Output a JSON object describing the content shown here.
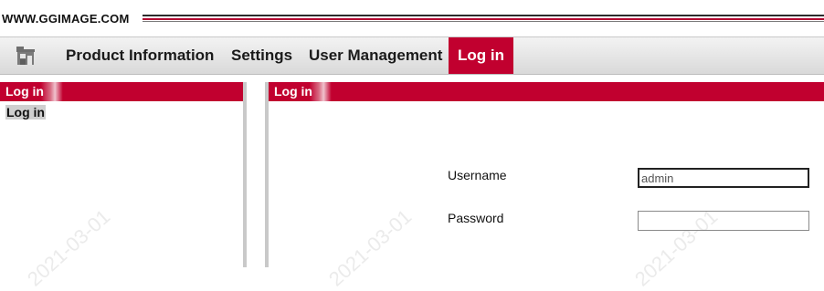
{
  "brand": {
    "site": "WWW.GGIMAGE.COM"
  },
  "nav": {
    "items": [
      {
        "label": "Product Information"
      },
      {
        "label": "Settings"
      },
      {
        "label": "User Management"
      },
      {
        "label": "Log in",
        "active": true
      }
    ],
    "home_icon": "home-icon"
  },
  "sidebar": {
    "header": "Log in",
    "link": "Log in"
  },
  "main": {
    "header": "Log in",
    "username_label": "Username",
    "username_value": "admin",
    "password_label": "Password",
    "password_value": ""
  },
  "watermark": {
    "date": "2021-03-01"
  },
  "colors": {
    "accent": "#c1002f",
    "nav_bg": "#e3e3e3",
    "divider": "#c9c9c9"
  }
}
